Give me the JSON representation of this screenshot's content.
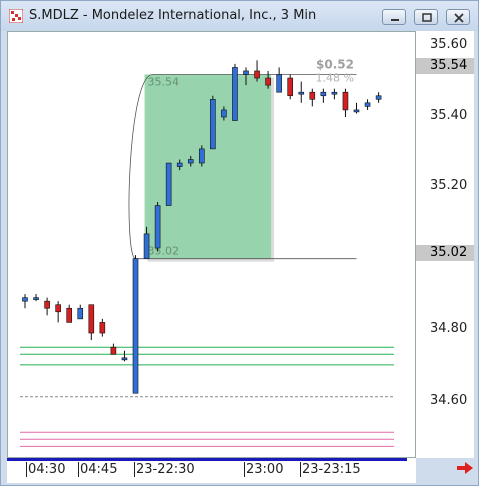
{
  "window": {
    "title": "S.MDLZ - Mondelez International, Inc., 3 Min",
    "buttons": [
      "minimize",
      "restore",
      "close"
    ]
  },
  "price_axis": {
    "ticks": [
      "35.60",
      "35.40",
      "35.20",
      "34.80",
      "34.60"
    ],
    "highlight_top": "35.54",
    "highlight_mid": "35.02"
  },
  "time_axis": {
    "labels": [
      "04:30",
      "04:45",
      "23-22:30",
      "23:00",
      "23-23:15"
    ]
  },
  "measurement": {
    "change": "$0.52",
    "percent": "1.48 %",
    "top_price": "35.54",
    "bottom_price": "35.02"
  },
  "colors": {
    "up": "#2f6fd6",
    "down": "#d42020",
    "range_fill": "#8fd3a8",
    "green_lines": "#20b050",
    "pink_lines": "#e26aa8",
    "accent_arrow": "#e02020"
  },
  "chart_data": {
    "type": "candlestick",
    "series": [
      {
        "x": "04:25",
        "open": 34.9,
        "high": 34.92,
        "low": 34.88,
        "close": 34.91
      },
      {
        "x": "04:28",
        "open": 34.91,
        "high": 34.92,
        "low": 34.9,
        "close": 34.91
      },
      {
        "x": "04:31",
        "open": 34.9,
        "high": 34.91,
        "low": 34.86,
        "close": 34.88
      },
      {
        "x": "04:34",
        "open": 34.89,
        "high": 34.9,
        "low": 34.84,
        "close": 34.87
      },
      {
        "x": "04:37",
        "open": 34.88,
        "high": 34.89,
        "low": 34.84,
        "close": 34.84
      },
      {
        "x": "04:40",
        "open": 34.85,
        "high": 34.89,
        "low": 34.85,
        "close": 34.88
      },
      {
        "x": "04:43",
        "open": 34.89,
        "high": 34.89,
        "low": 34.79,
        "close": 34.81
      },
      {
        "x": "04:46",
        "open": 34.84,
        "high": 34.85,
        "low": 34.8,
        "close": 34.81
      },
      {
        "x": "04:49",
        "open": 34.77,
        "high": 34.78,
        "low": 34.75,
        "close": 34.75
      },
      {
        "x": "04:52",
        "open": 34.74,
        "high": 34.76,
        "low": 34.73,
        "close": 34.74
      },
      {
        "x": "22:27",
        "open": 34.64,
        "high": 35.03,
        "low": 34.64,
        "close": 35.02
      },
      {
        "x": "22:30",
        "open": 35.02,
        "high": 35.11,
        "low": 35.02,
        "close": 35.09
      },
      {
        "x": "22:33",
        "open": 35.05,
        "high": 35.18,
        "low": 35.04,
        "close": 35.17
      },
      {
        "x": "22:36",
        "open": 35.17,
        "high": 35.29,
        "low": 35.17,
        "close": 35.29
      },
      {
        "x": "22:39",
        "open": 35.28,
        "high": 35.3,
        "low": 35.27,
        "close": 35.29
      },
      {
        "x": "22:42",
        "open": 35.29,
        "high": 35.31,
        "low": 35.28,
        "close": 35.3
      },
      {
        "x": "22:45",
        "open": 35.29,
        "high": 35.34,
        "low": 35.28,
        "close": 35.33
      },
      {
        "x": "22:48",
        "open": 35.33,
        "high": 35.48,
        "low": 35.33,
        "close": 35.47
      },
      {
        "x": "22:51",
        "open": 35.42,
        "high": 35.45,
        "low": 35.41,
        "close": 35.44
      },
      {
        "x": "22:54",
        "open": 35.41,
        "high": 35.57,
        "low": 35.41,
        "close": 35.56
      },
      {
        "x": "22:57",
        "open": 35.54,
        "high": 35.56,
        "low": 35.51,
        "close": 35.55
      },
      {
        "x": "23:00",
        "open": 35.55,
        "high": 35.58,
        "low": 35.52,
        "close": 35.53
      },
      {
        "x": "23:03",
        "open": 35.53,
        "high": 35.55,
        "low": 35.5,
        "close": 35.51
      },
      {
        "x": "23:06",
        "open": 35.49,
        "high": 35.56,
        "low": 35.49,
        "close": 35.54
      },
      {
        "x": "23:09",
        "open": 35.53,
        "high": 35.54,
        "low": 35.47,
        "close": 35.48
      },
      {
        "x": "23:12",
        "open": 35.49,
        "high": 35.52,
        "low": 35.46,
        "close": 35.49
      },
      {
        "x": "23:15",
        "open": 35.49,
        "high": 35.5,
        "low": 35.45,
        "close": 35.47
      },
      {
        "x": "23:18",
        "open": 35.48,
        "high": 35.5,
        "low": 35.46,
        "close": 35.49
      },
      {
        "x": "23:21",
        "open": 35.49,
        "high": 35.5,
        "low": 35.47,
        "close": 35.49
      },
      {
        "x": "23:24",
        "open": 35.49,
        "high": 35.5,
        "low": 35.42,
        "close": 35.44
      },
      {
        "x": "23:27",
        "open": 35.44,
        "high": 35.46,
        "low": 35.43,
        "close": 35.44
      },
      {
        "x": "23:30",
        "open": 35.45,
        "high": 35.47,
        "low": 35.44,
        "close": 35.46
      },
      {
        "x": "23:33",
        "open": 35.47,
        "high": 35.49,
        "low": 35.46,
        "close": 35.48
      }
    ],
    "ylim": [
      34.46,
      35.66
    ],
    "levels": {
      "green": [
        34.77,
        34.75,
        34.72
      ],
      "gray": [
        34.63
      ],
      "pink": [
        34.53,
        34.51,
        34.49
      ]
    }
  }
}
